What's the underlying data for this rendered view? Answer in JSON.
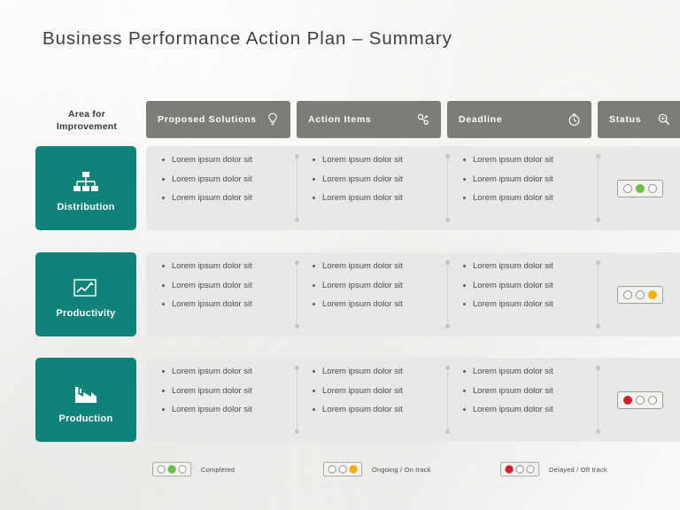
{
  "title": "Business Performance Action Plan – Summary",
  "colors": {
    "accent": "#0f8279",
    "header_bar": "#7b7d78",
    "panel": "#e8e8e6",
    "green": "#6cbf45",
    "amber": "#f0b000",
    "red": "#d81f26"
  },
  "headers": {
    "area": "Area for\nImprovement",
    "area_line1": "Area for",
    "area_line2": "Improvement",
    "columns": [
      {
        "label": "Proposed  Solutions",
        "icon": "lightbulb-icon"
      },
      {
        "label": "Action  Items",
        "icon": "settings-gear-icon"
      },
      {
        "label": "Deadline",
        "icon": "stopwatch-icon"
      },
      {
        "label": "Status",
        "icon": "magnifier-icon"
      }
    ]
  },
  "rows": [
    {
      "category": "Distribution",
      "icon": "org-chart-icon",
      "solutions": [
        "Lorem ipsum dolor sit",
        "Lorem ipsum dolor sit",
        "Lorem ipsum dolor sit"
      ],
      "actions": [
        "Lorem ipsum dolor sit",
        "Lorem ipsum dolor sit",
        "Lorem ipsum dolor sit"
      ],
      "deadlines": [
        "Lorem ipsum dolor sit",
        "Lorem ipsum dolor sit",
        "Lorem ipsum dolor sit"
      ],
      "status": "green"
    },
    {
      "category": "Productivity",
      "icon": "growth-chart-icon",
      "solutions": [
        "Lorem ipsum dolor sit",
        "Lorem ipsum dolor sit",
        "Lorem ipsum dolor sit"
      ],
      "actions": [
        "Lorem ipsum dolor sit",
        "Lorem ipsum dolor sit",
        "Lorem ipsum dolor sit"
      ],
      "deadlines": [
        "Lorem ipsum dolor sit",
        "Lorem ipsum dolor sit",
        "Lorem ipsum dolor sit"
      ],
      "status": "amber"
    },
    {
      "category": "Production",
      "icon": "factory-icon",
      "solutions": [
        "Lorem ipsum dolor sit",
        "Lorem ipsum dolor sit",
        "Lorem ipsum dolor sit"
      ],
      "actions": [
        "Lorem ipsum dolor sit",
        "Lorem ipsum dolor sit",
        "Lorem ipsum dolor sit"
      ],
      "deadlines": [
        "Lorem ipsum dolor sit",
        "Lorem ipsum dolor sit",
        "Lorem ipsum dolor sit"
      ],
      "status": "red"
    }
  ],
  "legend": [
    {
      "status": "green",
      "label": "Completed"
    },
    {
      "status": "amber",
      "label": "Ongoing / On track"
    },
    {
      "status": "red",
      "label": "Delayed / Off track"
    }
  ]
}
